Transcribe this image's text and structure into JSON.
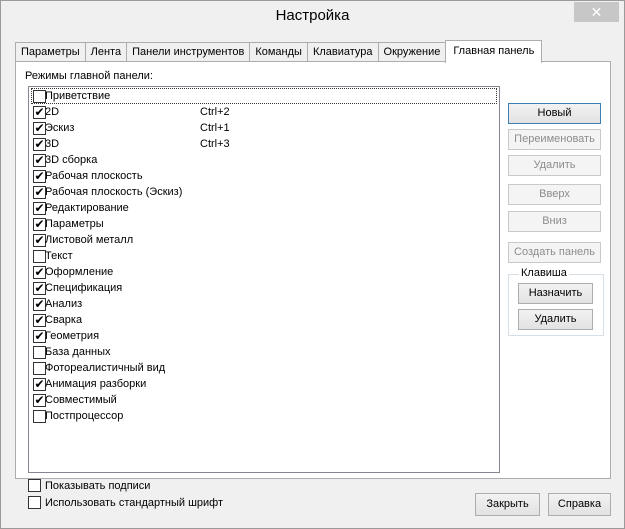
{
  "window": {
    "title": "Настройка",
    "close_symbol": "✕"
  },
  "tabs": [
    {
      "label": "Параметры",
      "active": false
    },
    {
      "label": "Лента",
      "active": false
    },
    {
      "label": "Панели инструментов",
      "active": false
    },
    {
      "label": "Команды",
      "active": false
    },
    {
      "label": "Клавиатура",
      "active": false
    },
    {
      "label": "Окружение",
      "active": false
    },
    {
      "label": "Главная панель",
      "active": true
    }
  ],
  "panel": {
    "modes_label": "Режимы главной панели:",
    "items": [
      {
        "label": "Приветствие",
        "checked": false,
        "shortcut": ""
      },
      {
        "label": "2D",
        "checked": true,
        "shortcut": "Ctrl+2"
      },
      {
        "label": "Эскиз",
        "checked": true,
        "shortcut": "Ctrl+1"
      },
      {
        "label": "3D",
        "checked": true,
        "shortcut": "Ctrl+3"
      },
      {
        "label": "3D сборка",
        "checked": true,
        "shortcut": ""
      },
      {
        "label": "Рабочая плоскость",
        "checked": true,
        "shortcut": ""
      },
      {
        "label": "Рабочая плоскость (Эскиз)",
        "checked": true,
        "shortcut": ""
      },
      {
        "label": "Редактирование",
        "checked": true,
        "shortcut": ""
      },
      {
        "label": "Параметры",
        "checked": true,
        "shortcut": ""
      },
      {
        "label": "Листовой металл",
        "checked": true,
        "shortcut": ""
      },
      {
        "label": "Текст",
        "checked": false,
        "shortcut": ""
      },
      {
        "label": "Оформление",
        "checked": true,
        "shortcut": ""
      },
      {
        "label": "Спецификация",
        "checked": true,
        "shortcut": ""
      },
      {
        "label": "Анализ",
        "checked": true,
        "shortcut": ""
      },
      {
        "label": "Сварка",
        "checked": true,
        "shortcut": ""
      },
      {
        "label": "Геометрия",
        "checked": true,
        "shortcut": ""
      },
      {
        "label": "База данных",
        "checked": false,
        "shortcut": ""
      },
      {
        "label": "Фотореалистичный вид",
        "checked": false,
        "shortcut": ""
      },
      {
        "label": "Анимация разборки",
        "checked": true,
        "shortcut": ""
      },
      {
        "label": "Совместимый",
        "checked": true,
        "shortcut": ""
      },
      {
        "label": "Постпроцессор",
        "checked": false,
        "shortcut": ""
      }
    ],
    "buttons": {
      "new": "Новый",
      "rename": "Переименовать",
      "delete": "Удалить",
      "up": "Вверх",
      "down": "Вниз",
      "create_panel": "Создать панель"
    },
    "key_group": {
      "label": "Клавиша",
      "assign": "Назначить",
      "delete": "Удалить"
    },
    "show_captions": {
      "label": "Показывать подписи",
      "checked": false
    },
    "standard_font": {
      "label": "Использовать стандартный шрифт",
      "checked": false
    }
  },
  "footer": {
    "close": "Закрыть",
    "help": "Справка"
  },
  "check_symbol": "✔"
}
